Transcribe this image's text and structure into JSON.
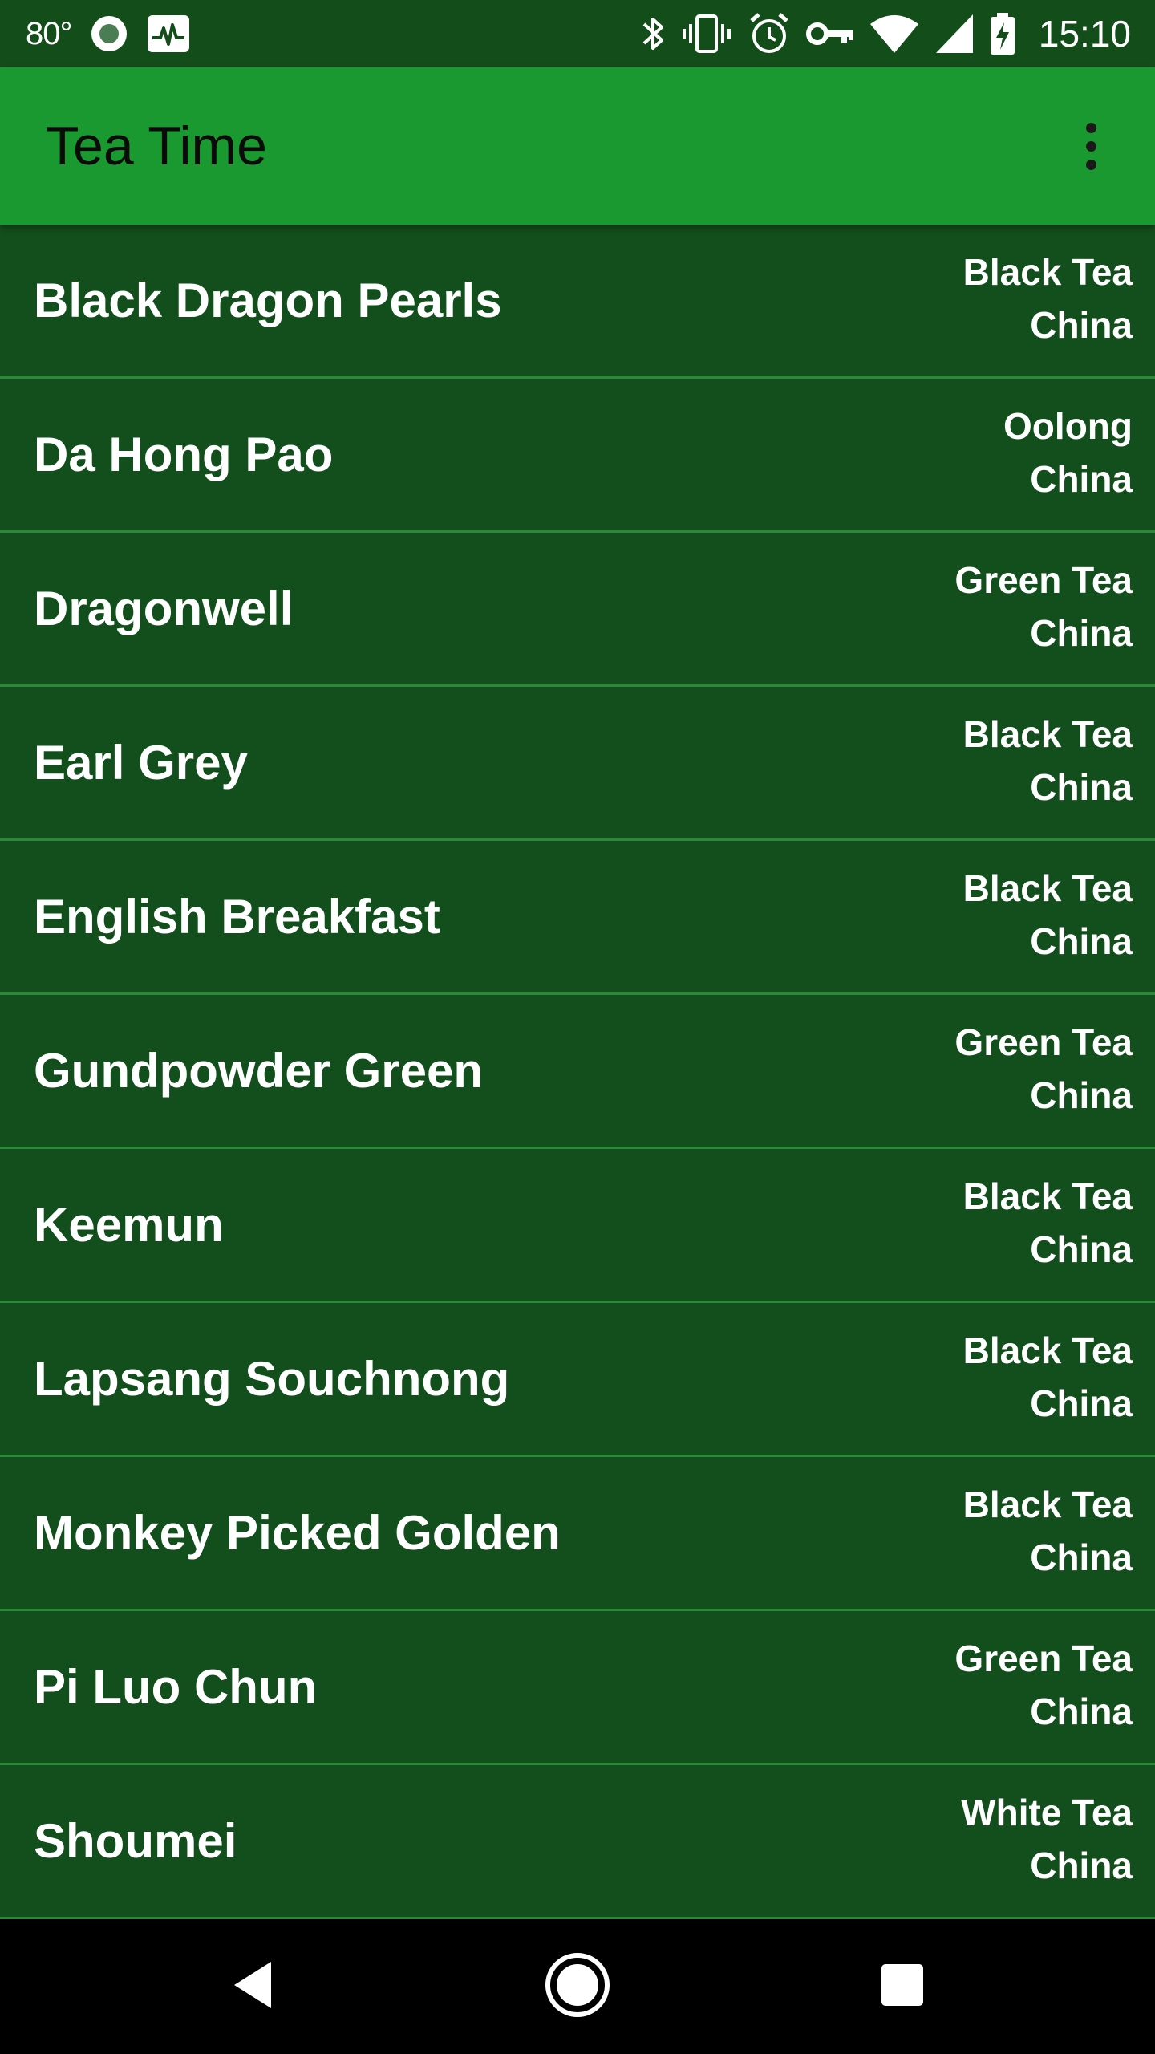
{
  "status_bar": {
    "temperature": "80°",
    "time": "15:10",
    "left_icons": [
      "record-circle-icon",
      "activity-monitor-icon"
    ],
    "right_icons": [
      "bluetooth-icon",
      "vibrate-icon",
      "alarm-icon",
      "vpn-key-icon",
      "wifi-icon",
      "cell-signal-icon",
      "battery-charging-icon"
    ]
  },
  "app_bar": {
    "title": "Tea Time",
    "menu_icon": "overflow-menu-icon"
  },
  "teas": [
    {
      "name": "Black Dragon Pearls",
      "type": "Black Tea",
      "country": "China"
    },
    {
      "name": "Da Hong Pao",
      "type": "Oolong",
      "country": "China"
    },
    {
      "name": "Dragonwell",
      "type": "Green Tea",
      "country": "China"
    },
    {
      "name": "Earl Grey",
      "type": "Black Tea",
      "country": "China"
    },
    {
      "name": "English Breakfast",
      "type": "Black Tea",
      "country": "China"
    },
    {
      "name": "Gundpowder Green",
      "type": "Green Tea",
      "country": "China"
    },
    {
      "name": "Keemun",
      "type": "Black Tea",
      "country": "China"
    },
    {
      "name": "Lapsang Souchnong",
      "type": "Black Tea",
      "country": "China"
    },
    {
      "name": "Monkey Picked Golden",
      "type": "Black Tea",
      "country": "China"
    },
    {
      "name": "Pi Luo Chun",
      "type": "Green Tea",
      "country": "China"
    },
    {
      "name": "Shoumei",
      "type": "White Tea",
      "country": "China"
    }
  ],
  "nav_bar": {
    "buttons": [
      "back-icon",
      "home-icon",
      "recents-icon"
    ]
  },
  "colors": {
    "status_bar": "#124d1a",
    "app_bar": "#1b9931",
    "list_background": "#124f1c",
    "divider": "#2a8a3a",
    "nav_bar": "#000000"
  }
}
